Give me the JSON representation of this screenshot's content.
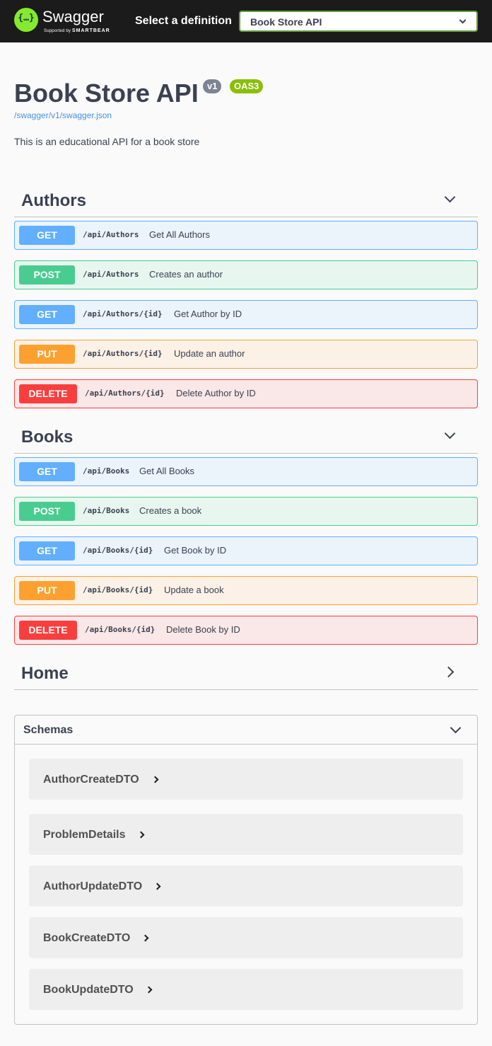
{
  "topbar": {
    "logo_glyph": "{…}",
    "logo_text": "Swagger",
    "logo_sub_prefix": "Supported by",
    "logo_sub_brand": "SMARTBEAR",
    "select_label": "Select a definition",
    "selected_definition": "Book Store API"
  },
  "info": {
    "title": "Book Store API",
    "version": "v1",
    "oas": "OAS3",
    "spec_url": "/swagger/v1/swagger.json",
    "description": "This is an educational API for a book store"
  },
  "tags": [
    {
      "name": "Authors",
      "expanded": true,
      "operations": [
        {
          "method": "GET",
          "path": "/api/Authors",
          "summary": "Get All Authors"
        },
        {
          "method": "POST",
          "path": "/api/Authors",
          "summary": "Creates an author"
        },
        {
          "method": "GET",
          "path": "/api/Authors/{id}",
          "summary": "Get Author by ID"
        },
        {
          "method": "PUT",
          "path": "/api/Authors/{id}",
          "summary": "Update an author"
        },
        {
          "method": "DELETE",
          "path": "/api/Authors/{id}",
          "summary": "Delete Author by ID"
        }
      ]
    },
    {
      "name": "Books",
      "expanded": true,
      "operations": [
        {
          "method": "GET",
          "path": "/api/Books",
          "summary": "Get All Books"
        },
        {
          "method": "POST",
          "path": "/api/Books",
          "summary": "Creates a book"
        },
        {
          "method": "GET",
          "path": "/api/Books/{id}",
          "summary": "Get Book by ID"
        },
        {
          "method": "PUT",
          "path": "/api/Books/{id}",
          "summary": "Update a book"
        },
        {
          "method": "DELETE",
          "path": "/api/Books/{id}",
          "summary": "Delete Book by ID"
        }
      ]
    },
    {
      "name": "Home",
      "expanded": false,
      "operations": []
    }
  ],
  "schemas": {
    "label": "Schemas",
    "models": [
      "AuthorCreateDTO",
      "ProblemDetails",
      "AuthorUpdateDTO",
      "BookCreateDTO",
      "BookUpdateDTO"
    ]
  },
  "colors": {
    "get": "#61affe",
    "post": "#49cc90",
    "put": "#fca130",
    "delete": "#f93e3e",
    "logo": "#85ea2d"
  }
}
